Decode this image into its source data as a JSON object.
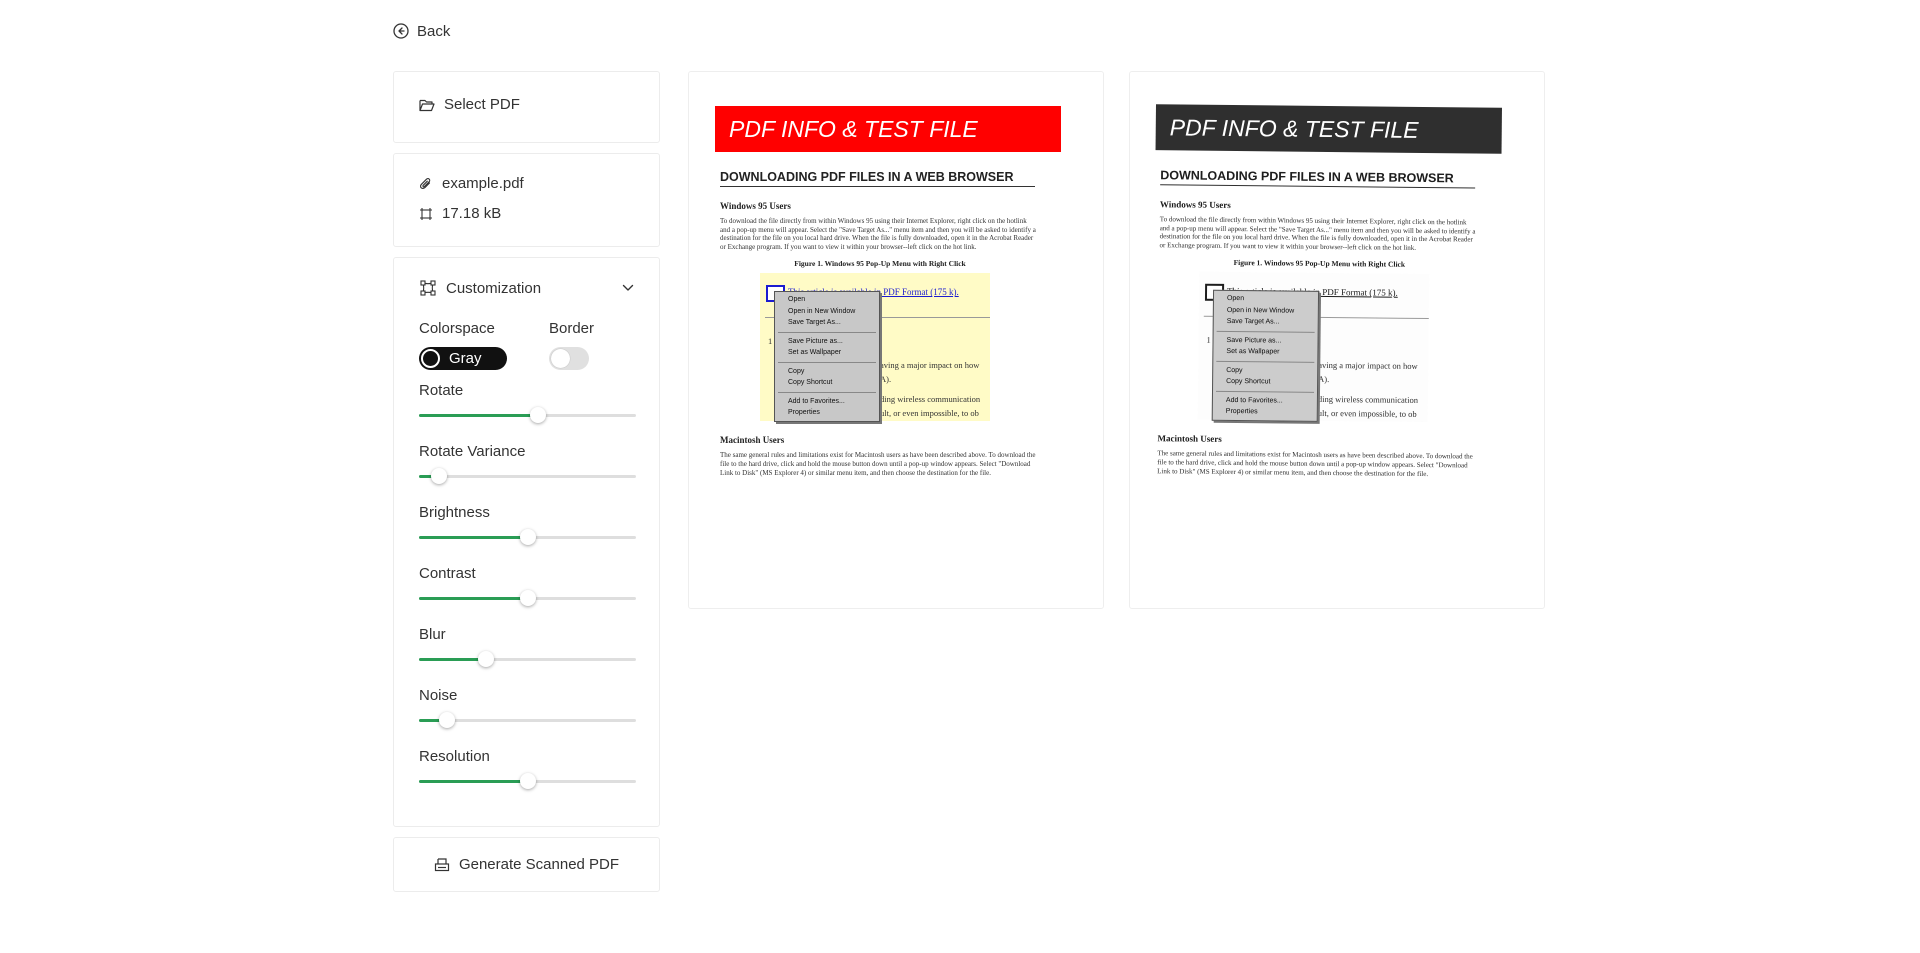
{
  "nav": {
    "back_label": "Back"
  },
  "sidebar": {
    "select_pdf_label": "Select PDF",
    "file": {
      "name": "example.pdf",
      "size": "17.18 kB"
    },
    "customization": {
      "title": "Customization",
      "colorspace": {
        "label": "Colorspace",
        "value": "Gray"
      },
      "border": {
        "label": "Border",
        "enabled": false
      },
      "sliders": [
        {
          "label": "Rotate",
          "value": 0.55
        },
        {
          "label": "Rotate Variance",
          "value": 0.09
        },
        {
          "label": "Brightness",
          "value": 0.5
        },
        {
          "label": "Contrast",
          "value": 0.5
        },
        {
          "label": "Blur",
          "value": 0.31
        },
        {
          "label": "Noise",
          "value": 0.13
        },
        {
          "label": "Resolution",
          "value": 0.5
        }
      ]
    },
    "generate_label": "Generate Scanned PDF"
  },
  "colors": {
    "accent": "#2a9d55",
    "banner_original": "#ff0000",
    "banner_scanned": "#333333"
  },
  "previews": {
    "banner": "PDF INFO & TEST FILE",
    "heading": "DOWNLOADING PDF FILES IN A WEB BROWSER",
    "section1": "Windows 95 Users",
    "para1": "To download the file directly from within Windows 95 using their Internet Explorer, right click on the hotlink and a pop-up menu will appear. Select the \"Save Target As...\" menu item and then you will be asked to identify a destination for the file on you local hard drive. When the file is fully downloaded, open it in the Acrobat Reader or Exchange program. If you want to view it within your browser--left click on the hot link.",
    "figure_caption": "Figure 1. Windows 95 Pop-Up Menu with Right Click",
    "screenshot_link": "This article is available in PDF Format (175 k).",
    "screenshot_frag1": "aving a major impact on how",
    "screenshot_frag2": "A).",
    "screenshot_frag3": "ding wireless communication",
    "screenshot_frag4": "ult, or even impossible, to ob",
    "menu_items": [
      "Open",
      "Open in New Window",
      "Save Target As...",
      "-",
      "Save Picture as...",
      "Set as Wallpaper",
      "-",
      "Copy",
      "Copy Shortcut",
      "-",
      "Add to Favorites...",
      "Properties"
    ],
    "section2": "Macintosh Users",
    "para2": "The same general rules and limitations exist for Macintosh users as have been described above. To download the file to the hard drive, click and hold the mouse button down until a pop-up window appears. Select \"Download Link to Disk\" (MS Explorer 4) or similar menu item, and then choose the destination for the file."
  }
}
